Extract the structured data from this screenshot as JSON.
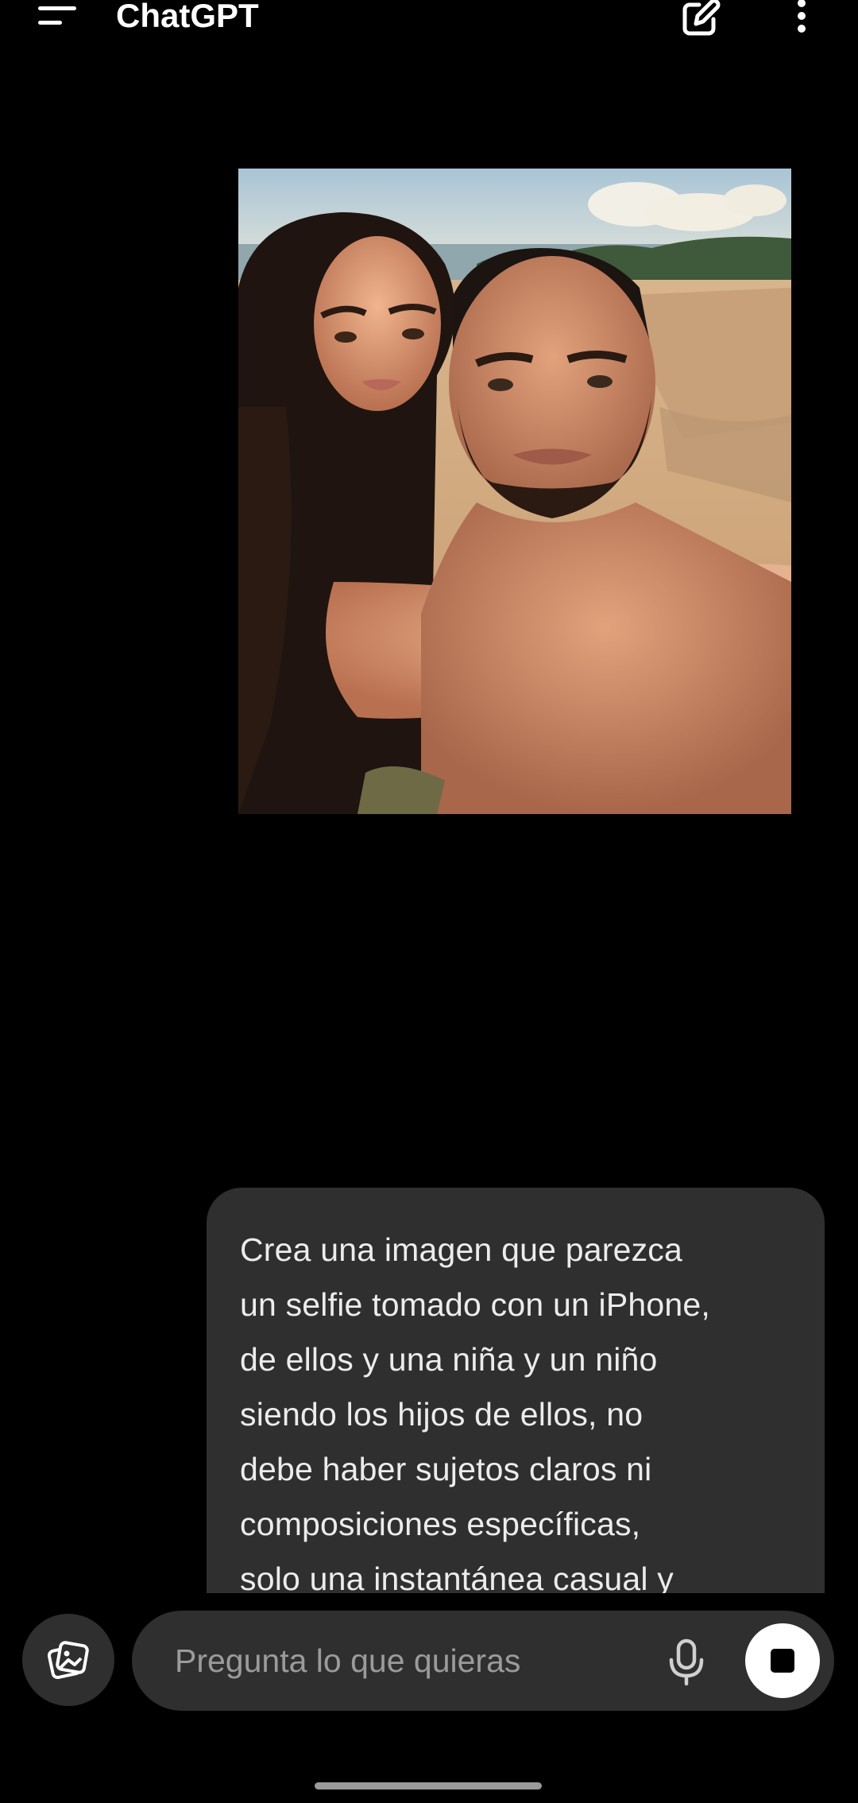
{
  "header": {
    "title": "ChatGPT"
  },
  "messages": [
    {
      "role": "user",
      "type": "image",
      "icon": "beach-selfie-photo"
    },
    {
      "role": "user",
      "type": "text",
      "text": "Crea una imagen que parezca\nun selfie tomado con un iPhone,\nde ellos y una niña y un niño\nsiendo los hijos de ellos, no\ndebe haber sujetos claros ni\ncomposiciones específicas,\nsolo una instantánea casual y"
    }
  ],
  "composer": {
    "placeholder": "Pregunta lo que quieras"
  },
  "icons": {
    "menu": "menu-icon",
    "new_chat": "edit-icon",
    "more": "more-vertical-icon",
    "attach": "image-attach-icon",
    "mic": "microphone-icon",
    "stop": "stop-icon"
  },
  "colors": {
    "background": "#000000",
    "bubble": "#2f2f2f",
    "text": "#ececec",
    "placeholder": "#9b9b9b",
    "stop_button": "#ffffff"
  }
}
